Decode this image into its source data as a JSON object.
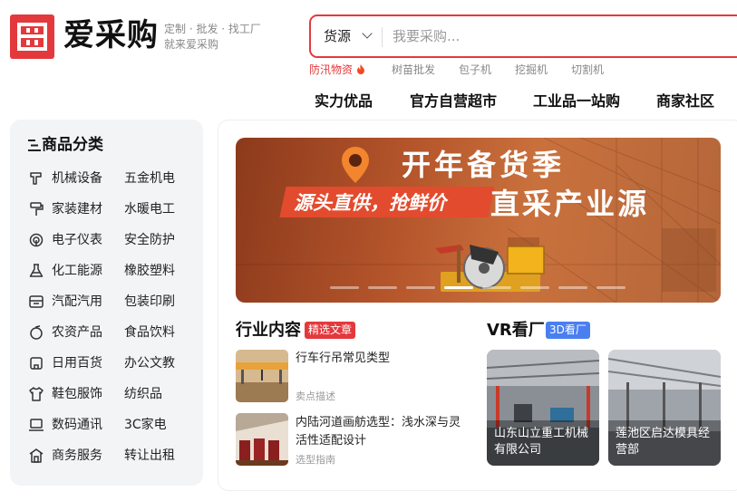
{
  "brand": {
    "name": "爱采购",
    "slogan_line1": "定制 · 批发 · 找工厂",
    "slogan_line2": "就来爱采购",
    "accent_color": "#e4393c"
  },
  "search": {
    "category": "货源",
    "placeholder": "我要采购..."
  },
  "hot_keywords": [
    "防汛物资",
    "树苗批发",
    "包子机",
    "挖掘机",
    "切割机"
  ],
  "top_nav": [
    "实力优品",
    "官方自营超市",
    "工业品一站购",
    "商家社区"
  ],
  "sidebar": {
    "title": "商品分类",
    "rows": [
      {
        "icon": "machine-icon",
        "left": "机械设备",
        "right": "五金机电"
      },
      {
        "icon": "paint-roller-icon",
        "left": "家装建材",
        "right": "水暖电工"
      },
      {
        "icon": "meter-icon",
        "left": "电子仪表",
        "right": "安全防护"
      },
      {
        "icon": "flask-icon",
        "left": "化工能源",
        "right": "橡胶塑料"
      },
      {
        "icon": "car-parts-icon",
        "left": "汽配汽用",
        "right": "包装印刷"
      },
      {
        "icon": "fruit-icon",
        "left": "农资产品",
        "right": "食品饮料"
      },
      {
        "icon": "bag-icon",
        "left": "日用百货",
        "right": "办公文教"
      },
      {
        "icon": "shirt-icon",
        "left": "鞋包服饰",
        "right": "纺织品"
      },
      {
        "icon": "laptop-icon",
        "left": "数码通讯",
        "right": "3C家电"
      },
      {
        "icon": "shop-icon",
        "left": "商务服务",
        "right": "转让出租"
      }
    ]
  },
  "banner": {
    "title": "开年备货季",
    "tag": "源头直供，抢鲜价",
    "subtitle": "直采产业源",
    "slide_count": 8,
    "active_slide": 4
  },
  "industry": {
    "title": "行业内容",
    "badge": "精选文章",
    "articles": [
      {
        "title": "行车行吊常见类型",
        "tag": "卖点描述"
      },
      {
        "title": "内陆河道画舫选型：浅水深与灵活性适配设计",
        "tag": "选型指南"
      }
    ]
  },
  "vr": {
    "title": "VR看厂",
    "badge": "3D看厂",
    "factories": [
      {
        "name": "山东山立重工机械有限公司"
      },
      {
        "name": "莲池区启达模具经营部"
      }
    ]
  }
}
